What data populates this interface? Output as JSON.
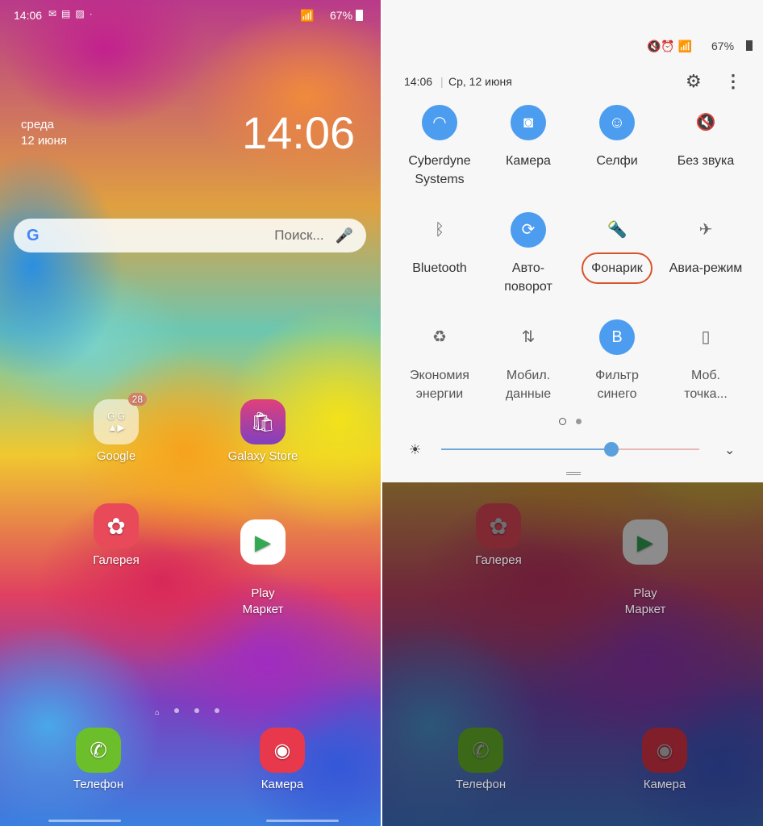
{
  "left": {
    "status": {
      "time": "14:06",
      "battery": "67%"
    },
    "clock": {
      "day": "среда",
      "date": "12 июня",
      "time": "14:06"
    },
    "search": {
      "placeholder": "Поиск..."
    },
    "apps": [
      {
        "label": "Google",
        "badge": "28"
      },
      {
        "label": "Galaxy Store"
      },
      {
        "label": "Галерея"
      },
      {
        "label": "Play\nМаркет"
      }
    ],
    "dock": [
      {
        "label": "Телефон"
      },
      {
        "label": "Камера"
      }
    ]
  },
  "panel": {
    "status": {
      "battery": "67%"
    },
    "time": "14:06",
    "date": "Ср, 12 июня",
    "tiles": [
      {
        "label": "Cyberdyne Systems",
        "icon": "wifi-icon",
        "on": true
      },
      {
        "label": "Камера",
        "icon": "camera-icon",
        "on": true
      },
      {
        "label": "Селфи",
        "icon": "selfie-icon",
        "on": true
      },
      {
        "label": "Без звука",
        "icon": "mute-icon",
        "on": false
      },
      {
        "label": "Bluetooth",
        "icon": "bluetooth-icon",
        "on": false
      },
      {
        "label": "Авто-поворот",
        "icon": "rotate-icon",
        "on": true
      },
      {
        "label": "Фонарик",
        "icon": "flashlight-icon",
        "on": false,
        "highlighted": true
      },
      {
        "label": "Авиа-режим",
        "icon": "airplane-icon",
        "on": false
      },
      {
        "label": "Экономия энергии",
        "icon": "power-saving-icon",
        "on": false
      },
      {
        "label": "Мобил. данные",
        "icon": "mobile-data-icon",
        "on": false
      },
      {
        "label": "Фильтр синего",
        "icon": "blue-filter-icon",
        "on": true
      },
      {
        "label": "Моб. точка...",
        "icon": "hotspot-icon",
        "on": false
      }
    ],
    "brightness": 0.66,
    "page": 1,
    "pages": 2,
    "accent": "#4c9df0",
    "highlight": "#d9542a"
  },
  "dimmed": {
    "apps": [
      {
        "label": "Галерея"
      },
      {
        "label": "Play\nМаркет"
      }
    ],
    "dock": [
      {
        "label": "Телефон"
      },
      {
        "label": "Камера"
      }
    ]
  }
}
